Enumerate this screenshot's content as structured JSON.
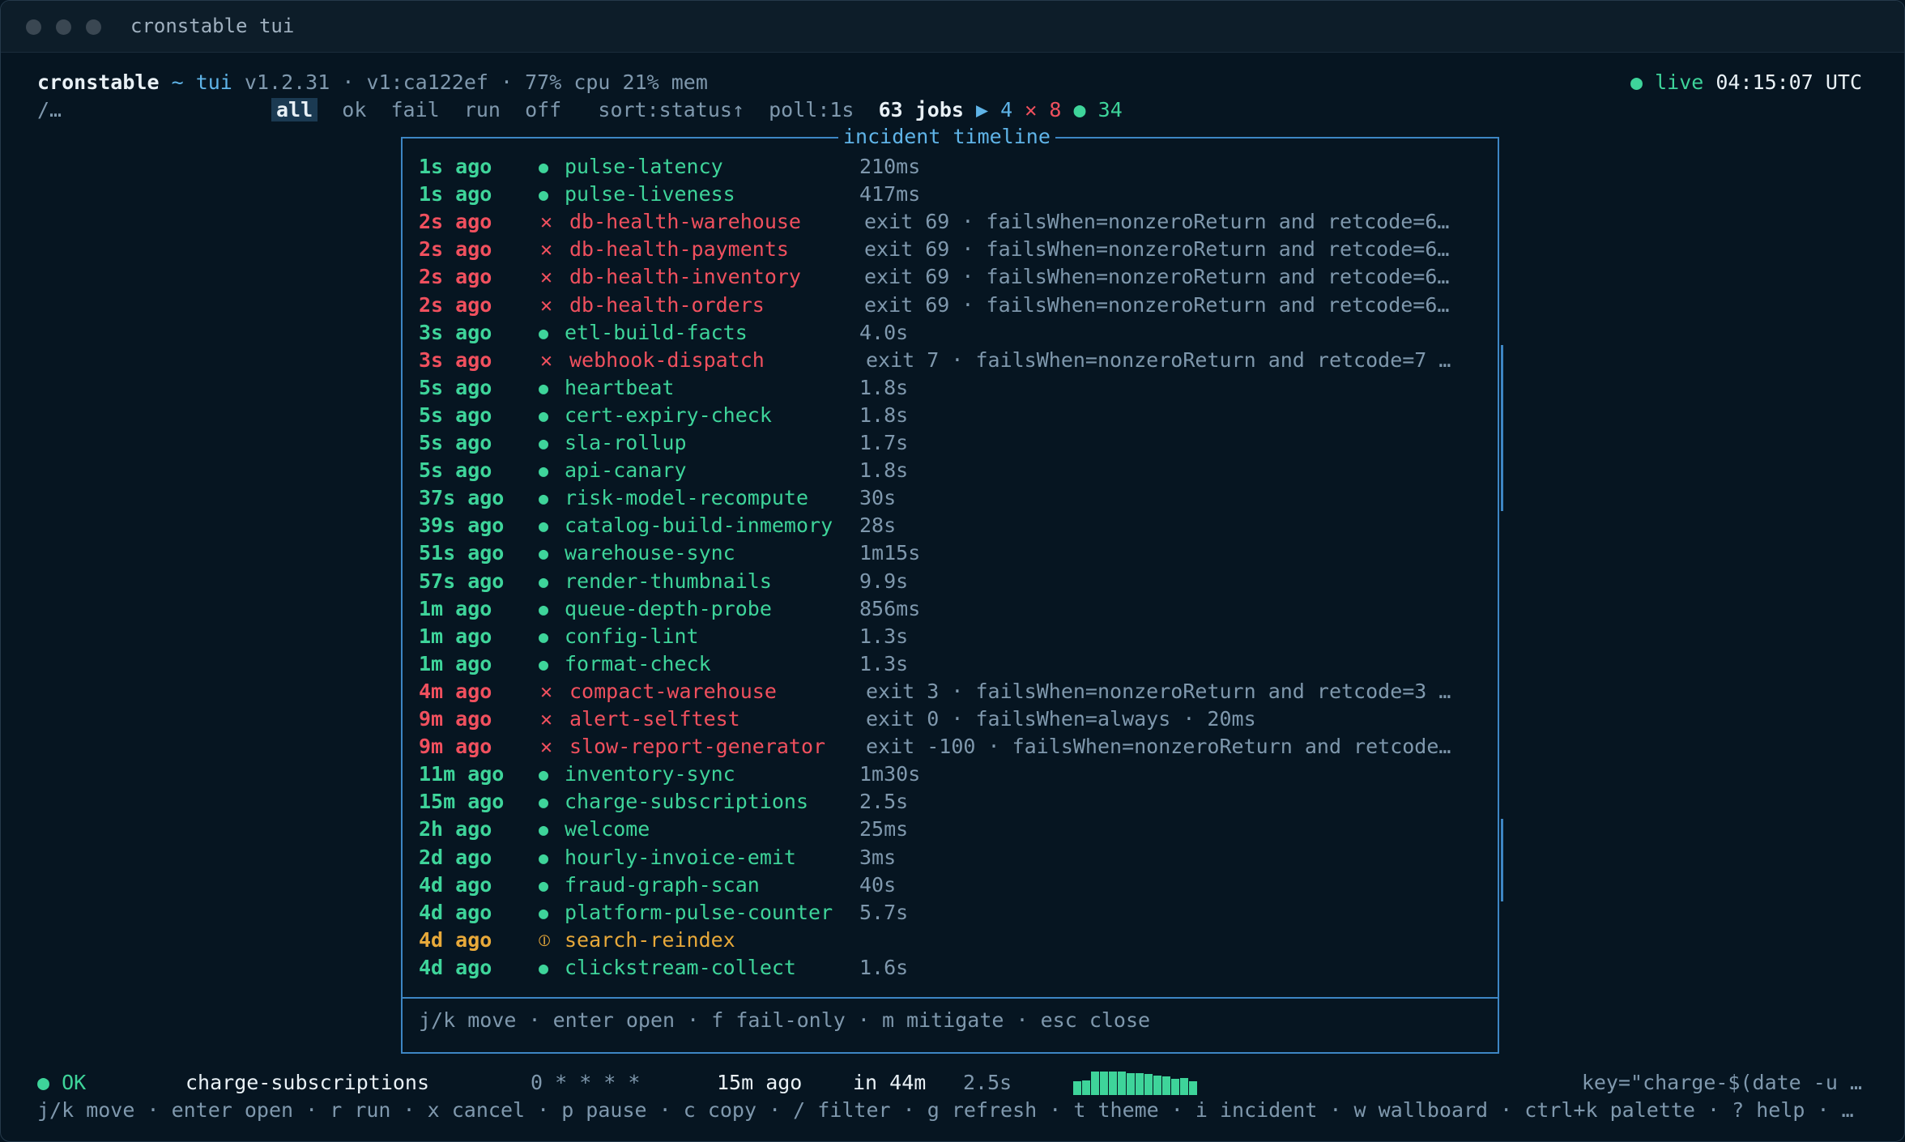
{
  "window": {
    "title": "cronstable tui"
  },
  "header": {
    "app": "cronstable",
    "sep": "~",
    "mode": "tui",
    "version": "v1.2.31",
    "build": "· v1:ca122ef ·",
    "resources": "77% cpu 21% mem",
    "live_dot": "●",
    "live": "live",
    "clock": "04:15:07 UTC"
  },
  "filterbar": {
    "prompt": "/…",
    "filters": [
      "all",
      "ok",
      "fail",
      "run",
      "off"
    ],
    "active": "all",
    "sort": "sort:status↑",
    "poll": "poll:1s",
    "jobs": "63 jobs",
    "run_icon": "▶",
    "run_count": "4",
    "fail_icon": "✕",
    "fail_count": "8",
    "ok_icon": "●",
    "ok_count": "34"
  },
  "incident_panel": {
    "title": "incident timeline",
    "rows": [
      {
        "time": "1s ago",
        "icon": "●",
        "name": "pulse-latency",
        "duration": "210ms",
        "detail": "",
        "status": "ok"
      },
      {
        "time": "1s ago",
        "icon": "●",
        "name": "pulse-liveness",
        "duration": "417ms",
        "detail": "",
        "status": "ok"
      },
      {
        "time": "2s ago",
        "icon": "✕",
        "name": "db-health-warehouse",
        "duration": "",
        "detail": "exit 69 · failsWhen=nonzeroReturn and retcode=6…",
        "status": "fail"
      },
      {
        "time": "2s ago",
        "icon": "✕",
        "name": "db-health-payments",
        "duration": "",
        "detail": "exit 69 · failsWhen=nonzeroReturn and retcode=6…",
        "status": "fail"
      },
      {
        "time": "2s ago",
        "icon": "✕",
        "name": "db-health-inventory",
        "duration": "",
        "detail": "exit 69 · failsWhen=nonzeroReturn and retcode=6…",
        "status": "fail"
      },
      {
        "time": "2s ago",
        "icon": "✕",
        "name": "db-health-orders",
        "duration": "",
        "detail": "exit 69 · failsWhen=nonzeroReturn and retcode=6…",
        "status": "fail"
      },
      {
        "time": "3s ago",
        "icon": "●",
        "name": "etl-build-facts",
        "duration": "4.0s",
        "detail": "",
        "status": "ok"
      },
      {
        "time": "3s ago",
        "icon": "✕",
        "name": "webhook-dispatch",
        "duration": "",
        "detail": "exit 7 · failsWhen=nonzeroReturn and retcode=7 …",
        "status": "fail"
      },
      {
        "time": "5s ago",
        "icon": "●",
        "name": "heartbeat",
        "duration": "1.8s",
        "detail": "",
        "status": "ok"
      },
      {
        "time": "5s ago",
        "icon": "●",
        "name": "cert-expiry-check",
        "duration": "1.8s",
        "detail": "",
        "status": "ok"
      },
      {
        "time": "5s ago",
        "icon": "●",
        "name": "sla-rollup",
        "duration": "1.7s",
        "detail": "",
        "status": "ok"
      },
      {
        "time": "5s ago",
        "icon": "●",
        "name": "api-canary",
        "duration": "1.8s",
        "detail": "",
        "status": "ok"
      },
      {
        "time": "37s ago",
        "icon": "●",
        "name": "risk-model-recompute",
        "duration": "30s",
        "detail": "",
        "status": "ok"
      },
      {
        "time": "39s ago",
        "icon": "●",
        "name": "catalog-build-inmemory",
        "duration": "28s",
        "detail": "",
        "status": "ok"
      },
      {
        "time": "51s ago",
        "icon": "●",
        "name": "warehouse-sync",
        "duration": "1m15s",
        "detail": "",
        "status": "ok"
      },
      {
        "time": "57s ago",
        "icon": "●",
        "name": "render-thumbnails",
        "duration": "9.9s",
        "detail": "",
        "status": "ok"
      },
      {
        "time": "1m ago",
        "icon": "●",
        "name": "queue-depth-probe",
        "duration": "856ms",
        "detail": "",
        "status": "ok"
      },
      {
        "time": "1m ago",
        "icon": "●",
        "name": "config-lint",
        "duration": "1.3s",
        "detail": "",
        "status": "ok"
      },
      {
        "time": "1m ago",
        "icon": "●",
        "name": "format-check",
        "duration": "1.3s",
        "detail": "",
        "status": "ok"
      },
      {
        "time": "4m ago",
        "icon": "✕",
        "name": "compact-warehouse",
        "duration": "",
        "detail": "exit 3 · failsWhen=nonzeroReturn and retcode=3 …",
        "status": "fail"
      },
      {
        "time": "9m ago",
        "icon": "✕",
        "name": "alert-selftest",
        "duration": "",
        "detail": "exit 0 · failsWhen=always · 20ms",
        "status": "fail"
      },
      {
        "time": "9m ago",
        "icon": "✕",
        "name": "slow-report-generator",
        "duration": "",
        "detail": "exit -100 · failsWhen=nonzeroReturn and retcode…",
        "status": "fail"
      },
      {
        "time": "11m ago",
        "icon": "●",
        "name": "inventory-sync",
        "duration": "1m30s",
        "detail": "",
        "status": "ok"
      },
      {
        "time": "15m ago",
        "icon": "●",
        "name": "charge-subscriptions",
        "duration": "2.5s",
        "detail": "",
        "status": "ok"
      },
      {
        "time": "2h ago",
        "icon": "●",
        "name": "welcome",
        "duration": "25ms",
        "detail": "",
        "status": "ok"
      },
      {
        "time": "2d ago",
        "icon": "●",
        "name": "hourly-invoice-emit",
        "duration": "3ms",
        "detail": "",
        "status": "ok"
      },
      {
        "time": "4d ago",
        "icon": "●",
        "name": "fraud-graph-scan",
        "duration": "40s",
        "detail": "",
        "status": "ok"
      },
      {
        "time": "4d ago",
        "icon": "●",
        "name": "platform-pulse-counter",
        "duration": "5.7s",
        "detail": "",
        "status": "ok"
      },
      {
        "time": "4d ago",
        "icon": "⦶",
        "name": "search-reindex",
        "duration": "",
        "detail": "",
        "status": "warn"
      },
      {
        "time": "4d ago",
        "icon": "●",
        "name": "clickstream-collect",
        "duration": "1.6s",
        "detail": "",
        "status": "ok"
      }
    ],
    "footer": "j/k move · enter open · f fail-only · m mitigate · esc close"
  },
  "statusbar": {
    "state_icon": "●",
    "state": "OK",
    "job": "charge-subscriptions",
    "schedule": "0 * * * *",
    "last": "15m ago",
    "next": "in 44m",
    "duration": "2.5s",
    "sparkline": [
      0.55,
      0.6,
      0.95,
      0.95,
      0.95,
      0.95,
      0.9,
      0.9,
      0.85,
      0.8,
      0.75,
      0.65,
      0.7,
      0.55
    ],
    "command": "key=\"charge-$(date -u …"
  },
  "helpbar": "j/k move · enter open · r run · x cancel · p pause · c copy · / filter · g refresh · t theme · i incident · w wallboard · ctrl+k palette · ? help · …",
  "colors": {
    "ok": "#3ed49a",
    "fail": "#f0505e",
    "warn": "#e8a93a",
    "accent": "#3d86c4",
    "bg": "#061521"
  }
}
